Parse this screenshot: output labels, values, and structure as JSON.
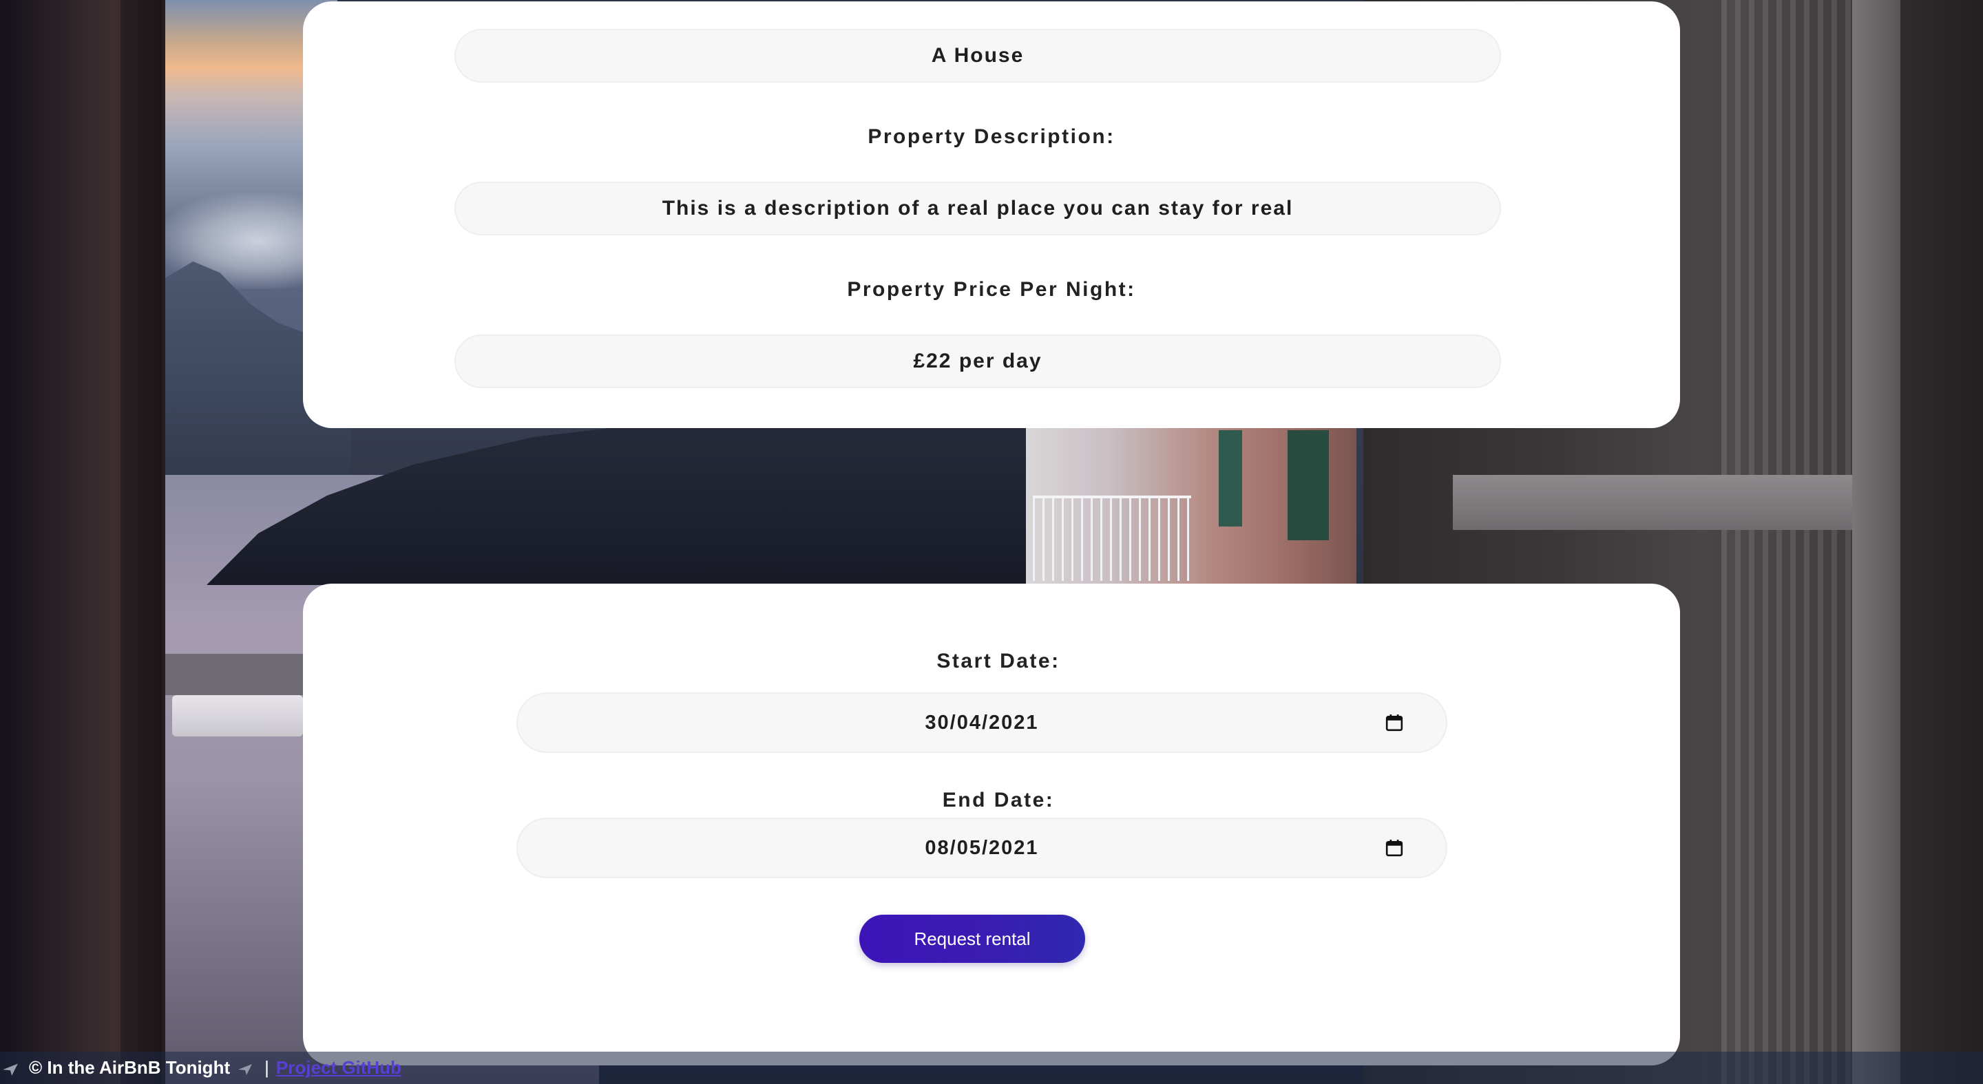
{
  "property": {
    "name_value": "A House",
    "description_label": "Property Description:",
    "description_value": "This is a description of a real place you can stay for real",
    "price_label": "Property Price Per Night:",
    "price_value": "£22 per day"
  },
  "booking": {
    "start_label": "Start Date:",
    "start_value": "30/04/2021",
    "end_label": "End Date:",
    "end_value": "08/05/2021",
    "request_button": "Request rental"
  },
  "footer": {
    "copyright": "© In the AirBnB Tonight",
    "separator": "|",
    "github_link": "Project GitHub"
  },
  "icons": {
    "date_picker": "calendar-icon",
    "footer_left": "plane-icon",
    "footer_right": "plane-icon"
  },
  "colors": {
    "button": "#3a1bb2",
    "card": "#ffffff",
    "field": "#f7f7f7",
    "link": "#5a3fd6"
  }
}
